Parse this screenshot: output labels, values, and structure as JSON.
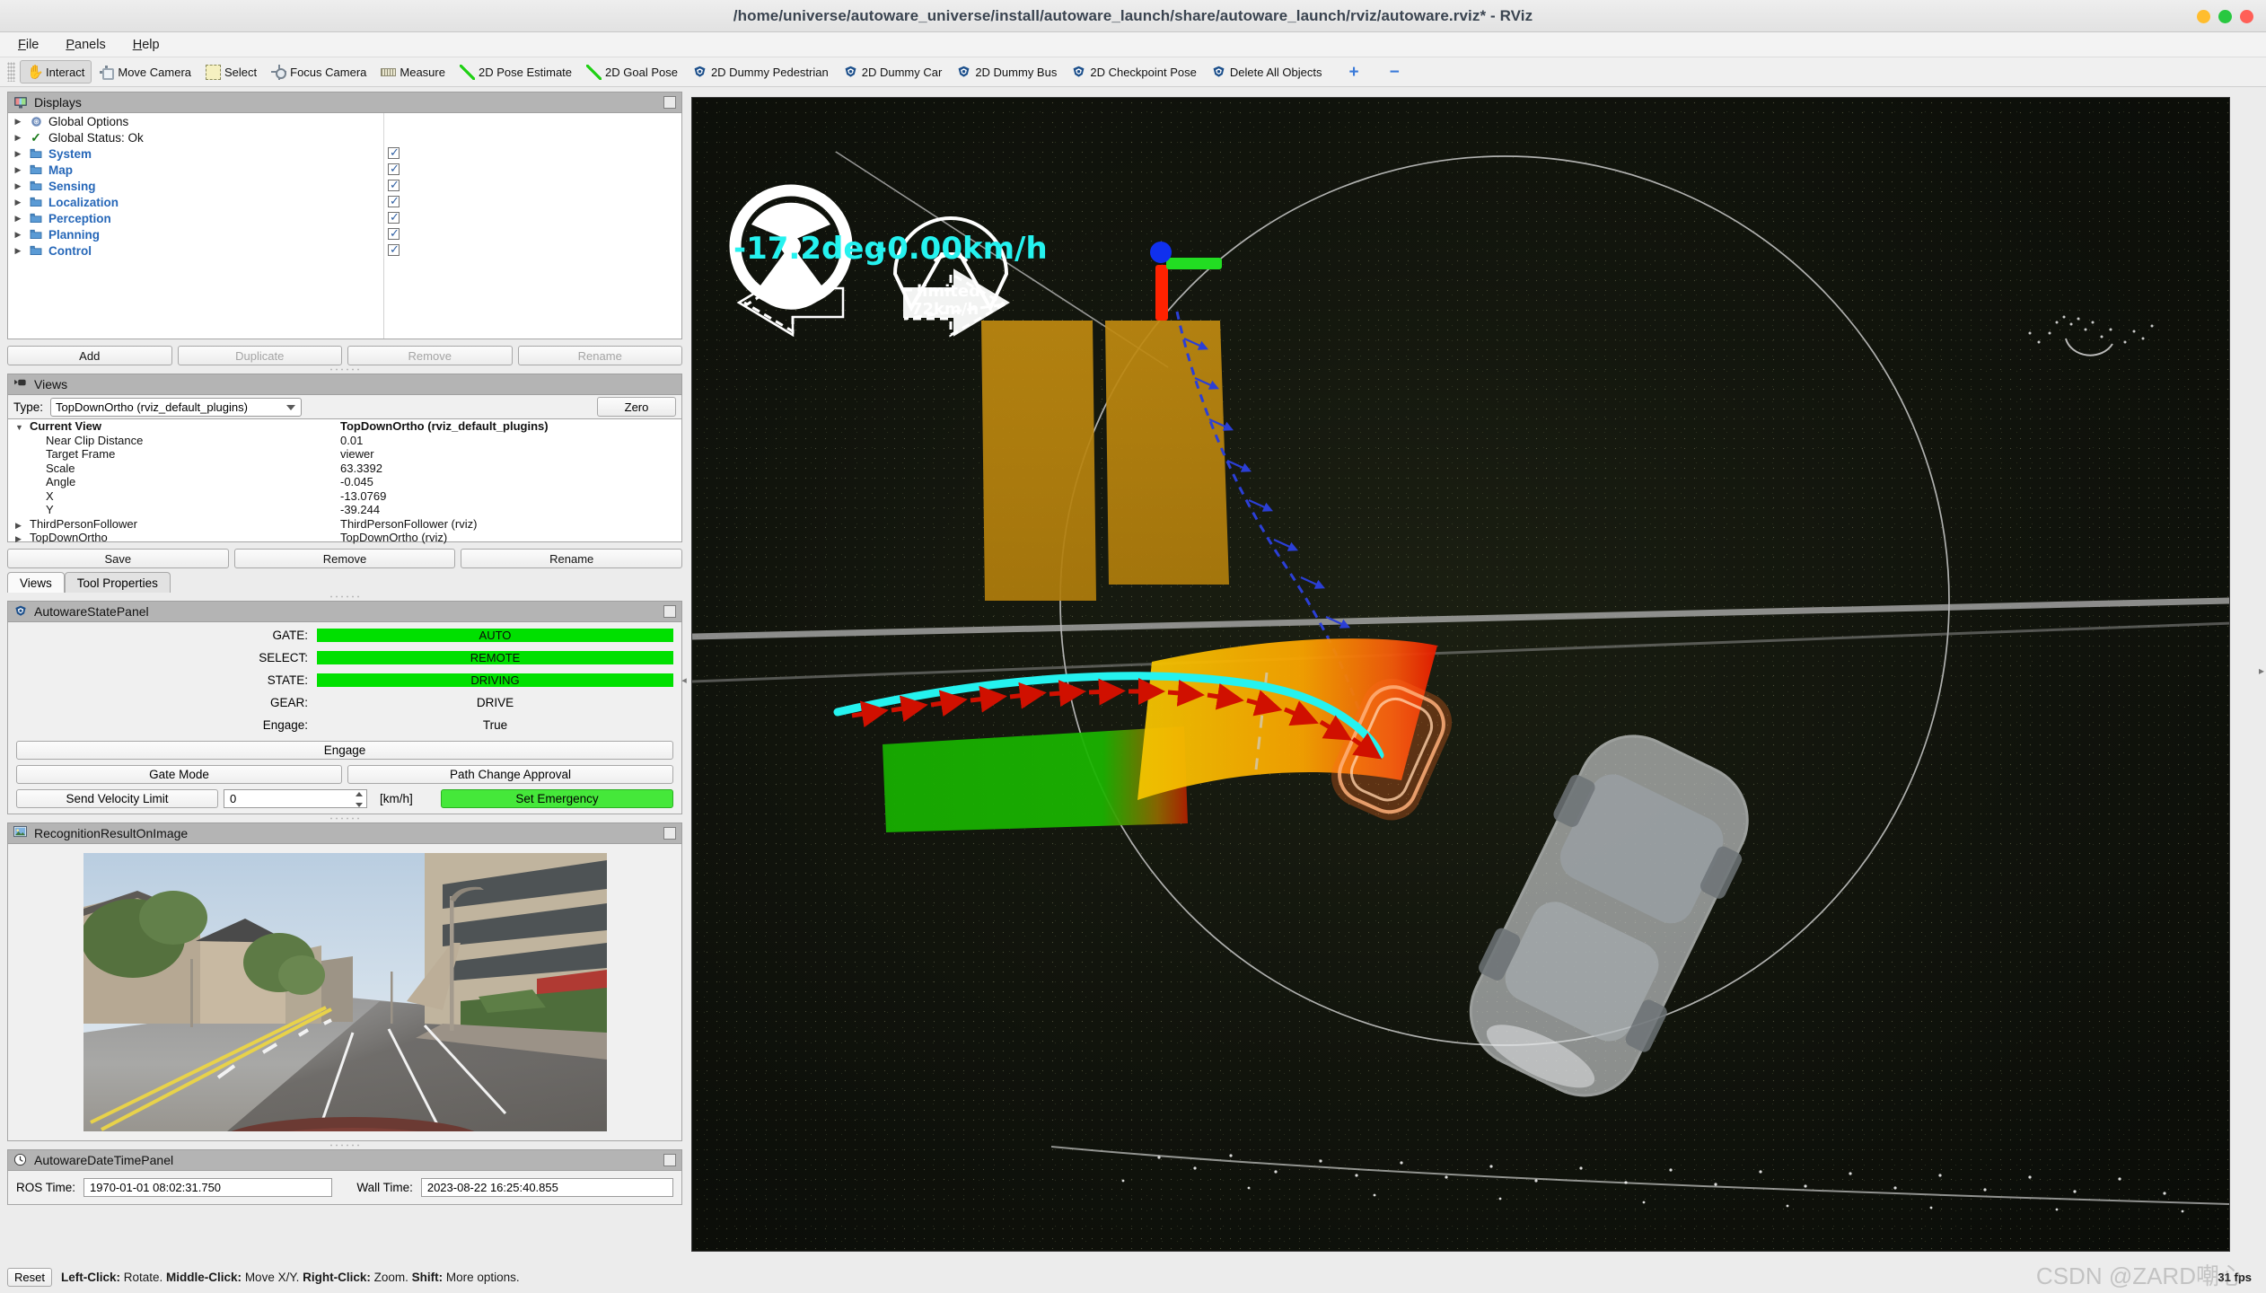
{
  "window": {
    "title": "/home/universe/autoware_universe/install/autoware_launch/share/autoware_launch/rviz/autoware.rviz* - RViz",
    "controls": {
      "minimize": "minimize",
      "maximize": "maximize",
      "close": "close"
    }
  },
  "menubar": {
    "items": [
      "File",
      "Panels",
      "Help"
    ]
  },
  "toolbar": {
    "items": [
      {
        "label": "Interact",
        "icon": "hand-icon",
        "active": true
      },
      {
        "label": "Move Camera",
        "icon": "move-camera-icon",
        "active": false
      },
      {
        "label": "Select",
        "icon": "select-icon",
        "active": false
      },
      {
        "label": "Focus Camera",
        "icon": "focus-camera-icon",
        "active": false
      },
      {
        "label": "Measure",
        "icon": "measure-icon",
        "active": false
      },
      {
        "label": "2D Pose Estimate",
        "icon": "pose-arrow-icon",
        "active": false
      },
      {
        "label": "2D Goal Pose",
        "icon": "pose-arrow-icon",
        "active": false
      },
      {
        "label": "2D Dummy Pedestrian",
        "icon": "autoware-icon",
        "active": false
      },
      {
        "label": "2D Dummy Car",
        "icon": "autoware-icon",
        "active": false
      },
      {
        "label": "2D Dummy Bus",
        "icon": "autoware-icon",
        "active": false
      },
      {
        "label": "2D Checkpoint Pose",
        "icon": "autoware-icon",
        "active": false
      },
      {
        "label": "Delete All Objects",
        "icon": "autoware-icon",
        "active": false
      }
    ],
    "add_tool_label": "+",
    "remove_tool_label": "−"
  },
  "displays": {
    "panel_title": "Displays",
    "rows": [
      {
        "label": "Global Options",
        "icon": "gear-icon",
        "group": false,
        "checkbox": null
      },
      {
        "label": "Global Status: Ok",
        "icon": "check-icon",
        "group": false,
        "checkbox": null
      },
      {
        "label": "System",
        "icon": "folder-icon",
        "group": true,
        "checkbox": true
      },
      {
        "label": "Map",
        "icon": "folder-icon",
        "group": true,
        "checkbox": true
      },
      {
        "label": "Sensing",
        "icon": "folder-icon",
        "group": true,
        "checkbox": true
      },
      {
        "label": "Localization",
        "icon": "folder-icon",
        "group": true,
        "checkbox": true
      },
      {
        "label": "Perception",
        "icon": "folder-icon",
        "group": true,
        "checkbox": true
      },
      {
        "label": "Planning",
        "icon": "folder-icon",
        "group": true,
        "checkbox": true
      },
      {
        "label": "Control",
        "icon": "folder-icon",
        "group": true,
        "checkbox": true
      }
    ],
    "buttons": [
      {
        "label": "Add",
        "enabled": true
      },
      {
        "label": "Duplicate",
        "enabled": false
      },
      {
        "label": "Remove",
        "enabled": false
      },
      {
        "label": "Rename",
        "enabled": false
      }
    ]
  },
  "views": {
    "panel_title": "Views",
    "type_label": "Type:",
    "type_value": "TopDownOrtho (rviz_default_plugins)",
    "zero_label": "Zero",
    "current_view_label": "Current View",
    "current_view_value": "TopDownOrtho (rviz_default_plugins)",
    "properties": [
      {
        "key": "Near Clip Distance",
        "value": "0.01"
      },
      {
        "key": "Target Frame",
        "value": "viewer"
      },
      {
        "key": "Scale",
        "value": "63.3392"
      },
      {
        "key": "Angle",
        "value": "-0.045"
      },
      {
        "key": "X",
        "value": "-13.0769"
      },
      {
        "key": "Y",
        "value": "-39.244"
      }
    ],
    "saved": [
      {
        "key": "ThirdPersonFollower",
        "value": "ThirdPersonFollower (rviz)"
      },
      {
        "key": "TopDownOrtho",
        "value": "TopDownOrtho (rviz)"
      }
    ],
    "buttons": [
      {
        "label": "Save"
      },
      {
        "label": "Remove"
      },
      {
        "label": "Rename"
      }
    ],
    "tabs": [
      {
        "label": "Views",
        "active": true
      },
      {
        "label": "Tool Properties",
        "active": false
      }
    ]
  },
  "state_panel": {
    "panel_title": "AutowareStatePanel",
    "rows": [
      {
        "label": "GATE:",
        "value": "AUTO",
        "style": "green"
      },
      {
        "label": "SELECT:",
        "value": "REMOTE",
        "style": "green"
      },
      {
        "label": "STATE:",
        "value": "DRIVING",
        "style": "green"
      },
      {
        "label": "GEAR:",
        "value": "DRIVE",
        "style": "plain"
      },
      {
        "label": "Engage:",
        "value": "True",
        "style": "plain"
      }
    ],
    "engage_button": "Engage",
    "gate_mode_button": "Gate Mode",
    "path_change_button": "Path Change Approval",
    "send_velocity_button": "Send Velocity Limit",
    "velocity_value": "0",
    "velocity_unit": "[km/h]",
    "emergency_button": "Set Emergency",
    "green_color": "#00e000",
    "emergency_color": "#45e83a"
  },
  "image_panel": {
    "panel_title": "RecognitionResultOnImage"
  },
  "datetime_panel": {
    "panel_title": "AutowareDateTimePanel",
    "ros_time_label": "ROS Time:",
    "ros_time_value": "1970-01-01 08:02:31.750",
    "wall_time_label": "Wall Time:",
    "wall_time_value": "2023-08-22 16:25:40.855"
  },
  "status_bar": {
    "reset_label": "Reset",
    "hint_parts": [
      {
        "bold": "Left-Click:",
        "text": " Rotate. "
      },
      {
        "bold": "Middle-Click:",
        "text": " Move X/Y. "
      },
      {
        "bold": "Right-Click:",
        "text": " Zoom. "
      },
      {
        "bold": "Shift:",
        "text": " More options."
      }
    ],
    "fps": "31 fps",
    "watermark": "CSDN @ZARD嘲心"
  },
  "viewport": {
    "steering_value": "-17.2deg",
    "speed_value": "-0.00km/h",
    "limited_label": "limited",
    "limited_value": "72km/h",
    "accent_cyan": "#25f2ef"
  }
}
